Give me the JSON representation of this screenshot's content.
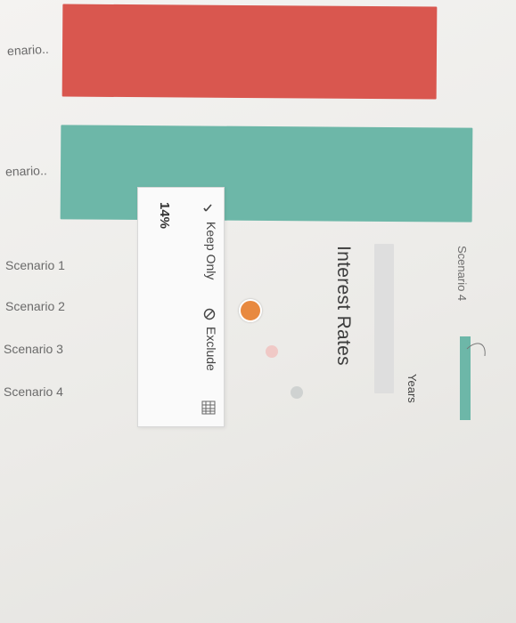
{
  "rows": {
    "row_a_label": "enario..",
    "row_b_label": "enario..",
    "scenario_labels": [
      "Scenario 1",
      "Scenario 2",
      "Scenario 3",
      "Scenario 4"
    ]
  },
  "bars": {
    "color_red": "#d9574f",
    "color_teal": "#6db7a8"
  },
  "tooltip": {
    "value": "14%",
    "keep_only": "Keep Only",
    "exclude": "Exclude"
  },
  "chart": {
    "title": "Interest Rates",
    "axis_label": "Years",
    "legend_partial": "Scenario 4"
  },
  "markers": {
    "selected_color": "#e8893f",
    "faded_color": "#f0c9c6",
    "gray_color": "#cfd2d1"
  }
}
